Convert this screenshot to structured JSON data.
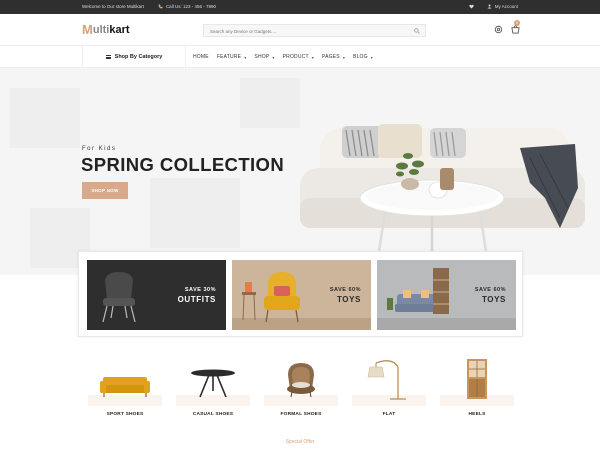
{
  "topbar": {
    "welcome": "Welcome to Our store Multikart",
    "call": "Call Us: 123 - 456 - 7890",
    "account": "My Account"
  },
  "header": {
    "logo_m": "M",
    "logo_rest1": "ulti",
    "logo_rest2": "kart",
    "search_placeholder": "Search any Device or Gadgets....",
    "cart_count": "0"
  },
  "nav": {
    "category_button": "Shop By Category",
    "items": [
      {
        "label": "HOME",
        "has_dropdown": false
      },
      {
        "label": "FEATURE",
        "has_dropdown": true
      },
      {
        "label": "SHOP",
        "has_dropdown": true
      },
      {
        "label": "PRODUCT",
        "has_dropdown": true
      },
      {
        "label": "PAGES",
        "has_dropdown": true
      },
      {
        "label": "BLOG",
        "has_dropdown": true
      }
    ]
  },
  "hero": {
    "kicker": "For Kids",
    "title": "SPRING COLLECTION",
    "button": "SHOP NOW"
  },
  "promos": [
    {
      "small": "SAVE 30%",
      "big": "OUTFITS"
    },
    {
      "small": "SAVE 60%",
      "big": "TOYS"
    },
    {
      "small": "SAVE 60%",
      "big": "TOYS"
    }
  ],
  "categories": [
    {
      "label": "SPORT SHOES",
      "icon": "sofa-icon"
    },
    {
      "label": "CASUAL SHOES",
      "icon": "side-table-icon"
    },
    {
      "label": "FORMAL SHOES",
      "icon": "rattan-chair-icon"
    },
    {
      "label": "FLAT",
      "icon": "floor-lamp-icon"
    },
    {
      "label": "HEELS",
      "icon": "cabinet-icon"
    }
  ],
  "section_heading": "Special Offer",
  "colors": {
    "accent": "#d6a27a",
    "topbar": "#2f2f2f",
    "button": "#d8a98a"
  }
}
